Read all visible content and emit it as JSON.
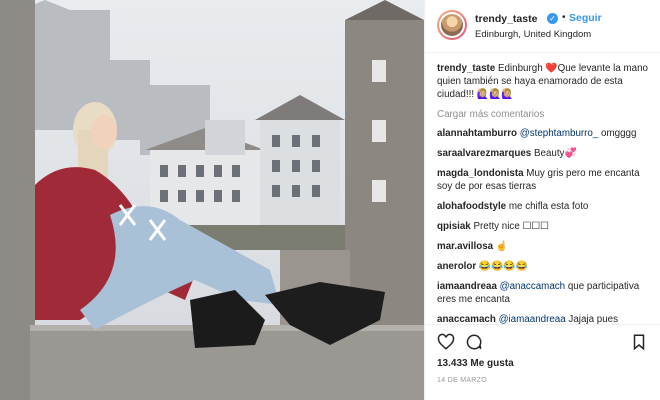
{
  "post": {
    "username": "trendy_taste",
    "follow_label": "Seguir",
    "location": "Edinburgh, United Kingdom",
    "caption_user": "trendy_taste",
    "caption_text": "Edinburgh ❤️Que levante la mano quien también se haya enamorado de esta ciudad!!! 🙋🏼‍♀️🙋🏼‍♀️🙋🏼‍♀️",
    "load_more": "Cargar más comentarios",
    "likes": "13.433 Me gusta",
    "date": "14 DE MARZO"
  },
  "comments": [
    {
      "user": "alannahtamburro",
      "mention": "@stephtamburro_",
      "text": " omgggg"
    },
    {
      "user": "saraalvarezmarques",
      "mention": "",
      "text": " Beauty💞"
    },
    {
      "user": "magda_londonista",
      "mention": "",
      "text": " Muy gris pero me encanta soy de por esas tierras"
    },
    {
      "user": "alohafoodstyle",
      "mention": "",
      "text": " me chifla esta foto"
    },
    {
      "user": "qpisiak",
      "mention": "",
      "text": " Pretty nice ☐☐☐"
    },
    {
      "user": "mar.avillosa",
      "mention": "",
      "text": " ☝️"
    },
    {
      "user": "anerolor",
      "mention": "",
      "text": " 😂😂😂😂"
    },
    {
      "user": "iamaandreaa",
      "mention": "@anaccamach",
      "text": " que participativa eres me encanta"
    },
    {
      "user": "anaccamach",
      "mention": "@iamaandreaa",
      "text": " Jajaja pues"
    }
  ],
  "icons": {
    "like": "heart-icon",
    "comment": "comment-icon",
    "save": "bookmark-icon",
    "verified": "verified-badge-icon"
  },
  "colors": {
    "accent": "#3897f0",
    "mention": "#003569",
    "muted": "#8e8e8e"
  }
}
